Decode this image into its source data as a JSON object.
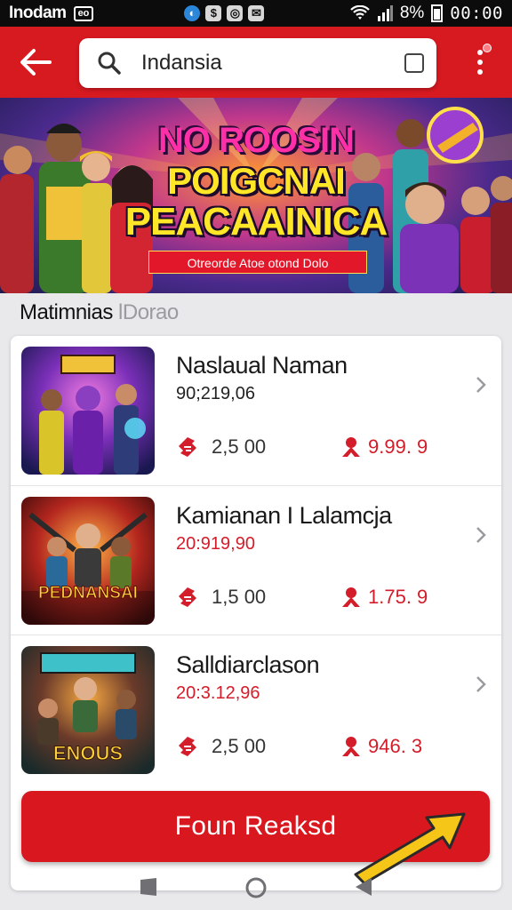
{
  "status_bar": {
    "carrier": "Inodam",
    "sim_label": "eo",
    "battery": "8%",
    "time": "00:00"
  },
  "app_bar": {
    "search_value": "Indansia"
  },
  "banner": {
    "title_line1": "NO ROOSIN",
    "title_line2": "POIGCNAI",
    "title_line3": "PEACAAINICA",
    "ribbon": "Otreorde Atoe otond Dolo"
  },
  "section": {
    "title": "Matimnias",
    "subtitle": "lDorao"
  },
  "items": [
    {
      "name": "Naslaual Naman",
      "code": "90;219,06",
      "code_red": false,
      "stat1": "2,5 00",
      "stat2": "9.99. 9"
    },
    {
      "name": "Kamianan I Lalamcja",
      "code": "20:919,90",
      "code_red": true,
      "stat1": "1,5 00",
      "stat2": "1.75. 9"
    },
    {
      "name": "Salldiarclason",
      "code": "20:3.12,96",
      "code_red": true,
      "stat1": "2,5 00",
      "stat2": "946. 3"
    }
  ],
  "thumb_text": {
    "item2": "PEDNANSAI",
    "item3": "ENOUS"
  },
  "cta": {
    "label": "Foun Reaksd"
  },
  "colors": {
    "brand_red": "#d71920",
    "accent_yellow": "#f5c518"
  },
  "icons": [
    "back-arrow-icon",
    "search-icon",
    "tabs-icon",
    "more-vert-icon",
    "ticket-icon",
    "star-burst-icon",
    "chevron-right-icon",
    "nav-back-icon",
    "nav-home-icon",
    "nav-recents-icon",
    "pointer-arrow-icon"
  ]
}
